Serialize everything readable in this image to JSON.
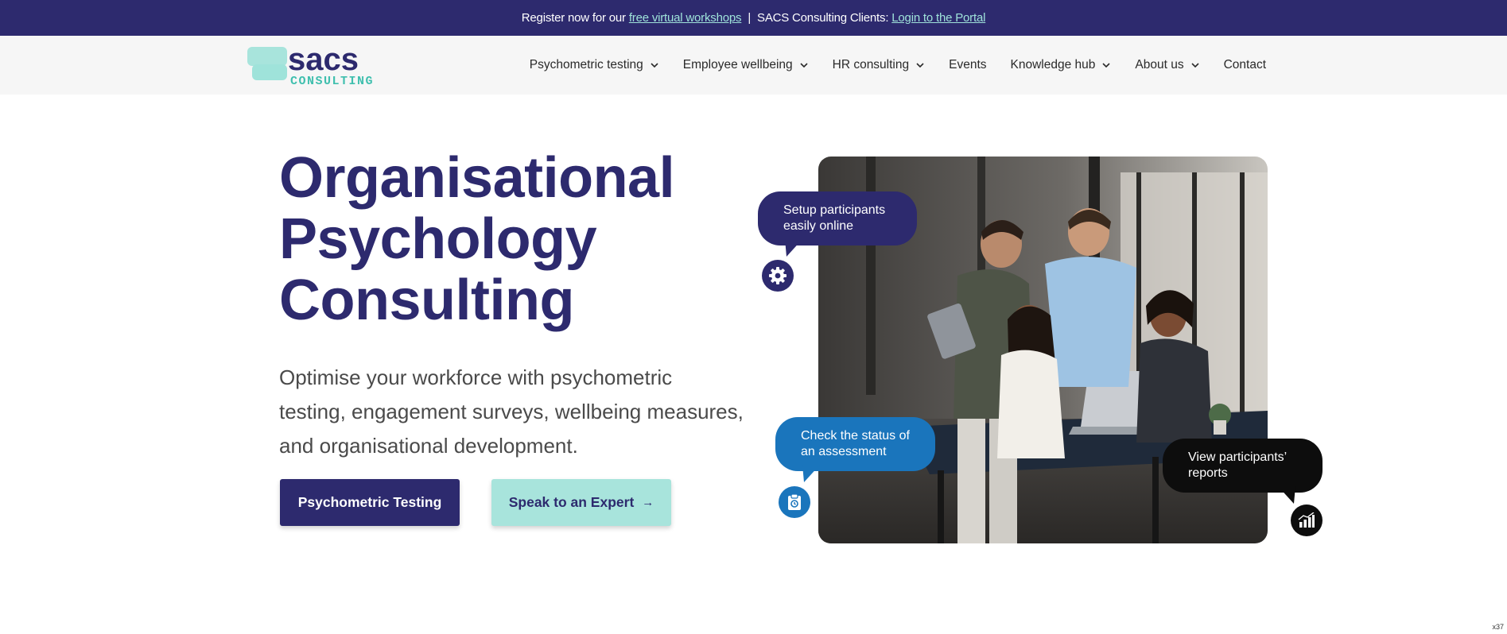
{
  "topbar": {
    "prefix": "Register now for our",
    "workshops_link": "free virtual workshops",
    "separator": "|",
    "clients_text": "SACS Consulting Clients:",
    "portal_link": "Login to the Portal"
  },
  "logo": {
    "word": "sacs",
    "sub": "CONSULTING"
  },
  "nav": {
    "items": [
      {
        "label": "Psychometric testing",
        "dropdown": true
      },
      {
        "label": "Employee wellbeing",
        "dropdown": true
      },
      {
        "label": "HR consulting",
        "dropdown": true
      },
      {
        "label": "Events",
        "dropdown": false
      },
      {
        "label": "Knowledge hub",
        "dropdown": true
      },
      {
        "label": "About us",
        "dropdown": true
      },
      {
        "label": "Contact",
        "dropdown": false
      }
    ]
  },
  "hero": {
    "title_line1": "Organisational",
    "title_line2": "Psychology",
    "title_line3": "Consulting",
    "sub_line1": "Optimise your workforce with psychometric",
    "sub_line2": "testing, engagement surveys, wellbeing measures,",
    "sub_line3": "and organisational development.",
    "primary_button": "Psychometric Testing",
    "secondary_button": "Speak to an Expert",
    "secondary_arrow": "→"
  },
  "bubbles": {
    "setup_line1": "Setup participants",
    "setup_line2": "easily online",
    "status_line1": "Check the status of",
    "status_line2": "an assessment",
    "reports_line1": "View participants’",
    "reports_line2": "reports"
  },
  "corner_tag": "x37",
  "colors": {
    "brand_navy": "#2d2a6e",
    "brand_teal": "#a8e4dc",
    "link_teal": "#9fe3da",
    "bubble_blue": "#1a75bc",
    "bubble_black": "#0d0d0d"
  },
  "icons": [
    "chevron-down-icon",
    "gear-icon",
    "clipboard-icon",
    "bar-chart-icon",
    "arrow-right-icon"
  ]
}
